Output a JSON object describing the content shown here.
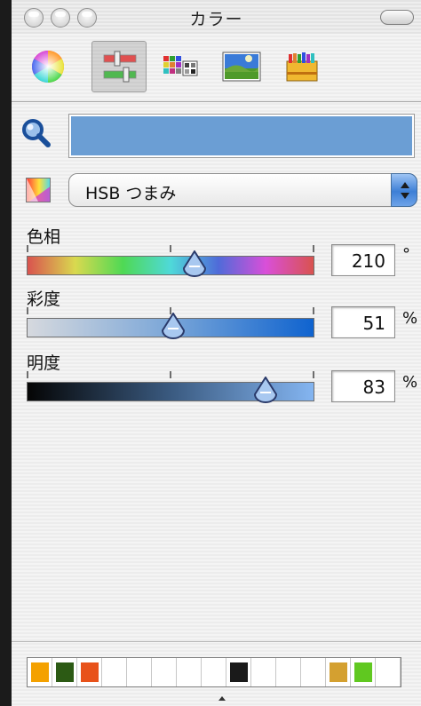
{
  "window": {
    "title": "カラー"
  },
  "toolbar": {
    "tools": [
      {
        "name": "color-wheel",
        "selected": false
      },
      {
        "name": "color-sliders",
        "selected": true
      },
      {
        "name": "color-palettes",
        "selected": false
      },
      {
        "name": "image-palettes",
        "selected": false
      },
      {
        "name": "crayons",
        "selected": false
      }
    ]
  },
  "current_color": "#6b9ed4",
  "mode": {
    "selected": "HSB つまみ"
  },
  "sliders": [
    {
      "label": "色相",
      "value": "210",
      "unit": "°",
      "fraction": 0.583,
      "colors": [
        "#d9534f",
        "#d9d94f",
        "#4fd954",
        "#4fd9d9",
        "#4f6bd9",
        "#d94fd9",
        "#d9534f"
      ]
    },
    {
      "label": "彩度",
      "value": "51",
      "unit": "%",
      "fraction": 0.51,
      "colors": [
        "#d6d9de",
        "#7aa6d8",
        "#0f63cf"
      ]
    },
    {
      "label": "明度",
      "value": "83",
      "unit": "%",
      "fraction": 0.83,
      "colors": [
        "#050505",
        "#3a5a80",
        "#84b5f1"
      ]
    }
  ],
  "swatches": [
    "#f4a100",
    "#2c5a14",
    "#e8521a",
    "#ffffff",
    "#ffffff",
    "#ffffff",
    "#ffffff",
    "#ffffff",
    "#1a1a1a",
    "#ffffff",
    "#ffffff",
    "#ffffff",
    "#d4a030",
    "#60c820",
    "#ffffff"
  ]
}
